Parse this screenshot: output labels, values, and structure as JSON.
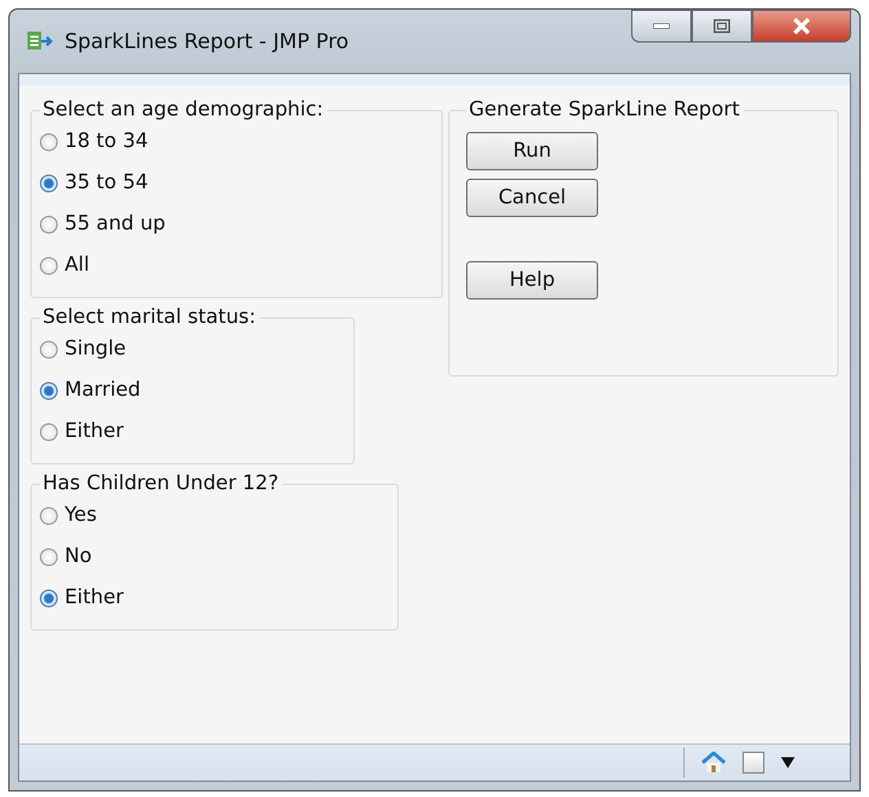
{
  "window": {
    "title": "SparkLines Report - JMP Pro"
  },
  "groups": [
    {
      "title": "Select an age demographic:",
      "options": [
        {
          "label": "18 to 34",
          "selected": false
        },
        {
          "label": "35 to 54",
          "selected": true
        },
        {
          "label": "55 and up",
          "selected": false
        },
        {
          "label": "All",
          "selected": false
        }
      ]
    },
    {
      "title": "Select marital status:",
      "options": [
        {
          "label": "Single",
          "selected": false
        },
        {
          "label": "Married",
          "selected": true
        },
        {
          "label": "Either",
          "selected": false
        }
      ]
    },
    {
      "title": "Has Children Under 12?",
      "options": [
        {
          "label": "Yes",
          "selected": false
        },
        {
          "label": "No",
          "selected": false
        },
        {
          "label": "Either",
          "selected": true
        }
      ]
    }
  ],
  "report": {
    "title": "Generate SparkLine Report",
    "buttons": [
      {
        "label": "Run"
      },
      {
        "label": "Cancel"
      },
      {
        "label": "Help"
      }
    ]
  },
  "status_bar": {
    "checkbox": {
      "checked": false
    }
  }
}
